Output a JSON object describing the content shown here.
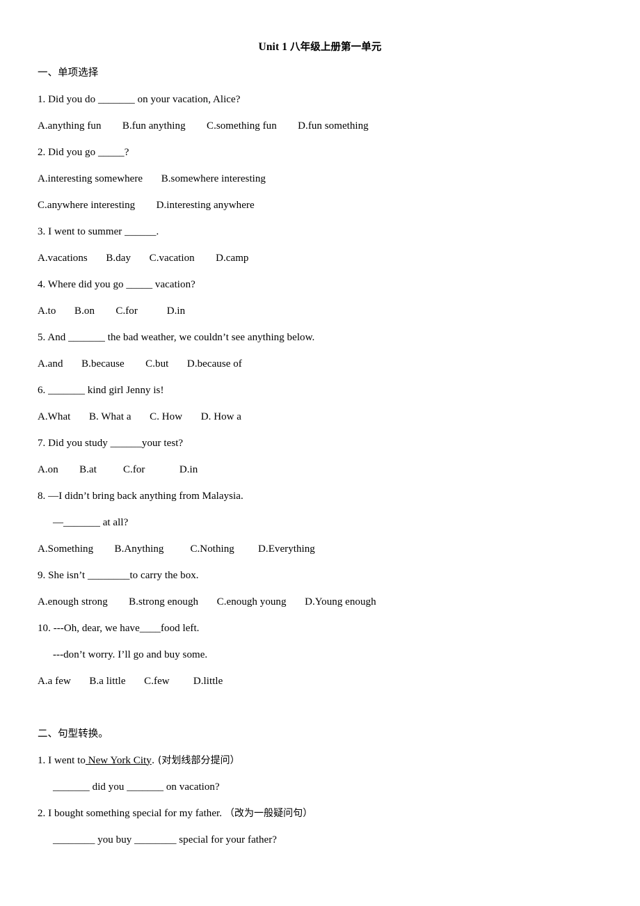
{
  "document": {
    "title_latin": "Unit 1 ",
    "title_cjk": "八年级上册第一单元",
    "background_color": "#ffffff",
    "text_color": "#000000"
  },
  "sections": [
    {
      "heading": "一、单项选择",
      "questions": [
        {
          "stem": "1. Did you do _______ on your vacation, Alice?",
          "options": "A.anything fun        B.fun anything        C.something fun        D.fun something"
        },
        {
          "stem": "2. Did you go _____?",
          "options_line1": "A.interesting somewhere       B.somewhere interesting",
          "options_line2": "C.anywhere interesting        D.interesting anywhere"
        },
        {
          "stem": "3. I went to summer ______.",
          "options": "A.vacations       B.day       C.vacation        D.camp"
        },
        {
          "stem": "4. Where did you go _____ vacation?",
          "options": "A.to       B.on        C.for           D.in"
        },
        {
          "stem": "5. And _______ the bad weather, we couldn’t see anything below.",
          "options": "A.and       B.because        C.but       D.because of"
        },
        {
          "stem": "6. _______ kind girl Jenny is!",
          "options": "A.What       B. What a       C. How       D. How a"
        },
        {
          "stem": "7. Did you study ______your test?",
          "options": "A.on        B.at          C.for             D.in"
        },
        {
          "stem": "8. —I didn’t bring back anything from Malaysia.",
          "stem_line2": "—_______ at all?",
          "options": "A.Something        B.Anything          C.Nothing         D.Everything"
        },
        {
          "stem": "9. She isn’t ________to carry the box.",
          "options": "A.enough strong        B.strong enough       C.enough young       D.Young enough"
        },
        {
          "stem": "10. ---Oh, dear, we have____food left.",
          "stem_line2": "---don’t worry. I’ll go and buy some.",
          "options": "A.a few       B.a little       C.few         D.little"
        }
      ]
    },
    {
      "heading": "二、句型转换。",
      "questions": [
        {
          "stem_prefix": "1. I went to",
          "stem_underlined": " New York City",
          "stem_suffix": ". (对划线部分提问）",
          "answer_line": "_______ did you _______ on vacation?"
        },
        {
          "stem_prefix": "2. I bought something special for my father. ",
          "stem_cjk": "（改为一般疑问句）",
          "answer_line": "________ you buy ________ special for your father?"
        }
      ]
    }
  ]
}
